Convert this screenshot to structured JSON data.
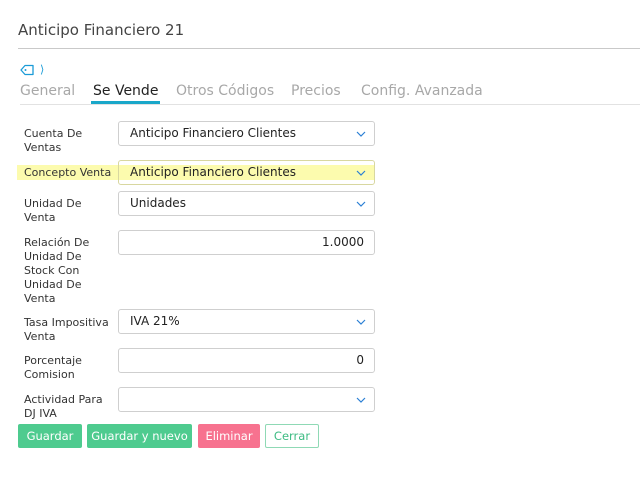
{
  "header": {
    "title": "Anticipo Financiero 21"
  },
  "tag_row": {
    "tag_icon": "tag-icon",
    "chevron_icon": "chevron-right-icon",
    "chevron_glyph": "⟩"
  },
  "tabs": [
    {
      "label": "General",
      "active": false
    },
    {
      "label": "Se Vende",
      "active": true
    },
    {
      "label": "Otros Códigos",
      "active": false
    },
    {
      "label": "Precios",
      "active": false
    },
    {
      "label": "Config. Avanzada",
      "active": false
    }
  ],
  "form": {
    "cuenta_ventas": {
      "label": "Cuenta De Ventas",
      "value": "Anticipo Financiero Clientes"
    },
    "concepto_venta": {
      "label": "Concepto Venta",
      "value": "Anticipo Financiero Clientes"
    },
    "unidad_venta": {
      "label": "Unidad De Venta",
      "value": "Unidades"
    },
    "relacion_unidad": {
      "label": "Relación De Unidad De Stock Con Unidad De Venta",
      "value": "1.0000"
    },
    "tasa_impositiva": {
      "label": "Tasa Impositiva Venta",
      "value": "IVA 21%"
    },
    "porcentaje_comision": {
      "label": "Porcentaje Comision",
      "value": "0"
    },
    "actividad_dj_iva": {
      "label": "Actividad Para DJ IVA",
      "value": ""
    }
  },
  "buttons": {
    "guardar": "Guardar",
    "guardar_nuevo": "Guardar y nuevo",
    "eliminar": "Eliminar",
    "cerrar": "Cerrar"
  },
  "colors": {
    "accent": "#19a7c9",
    "highlight": "#fcfbae",
    "success": "#4ecb8f",
    "danger": "#f7728f"
  }
}
